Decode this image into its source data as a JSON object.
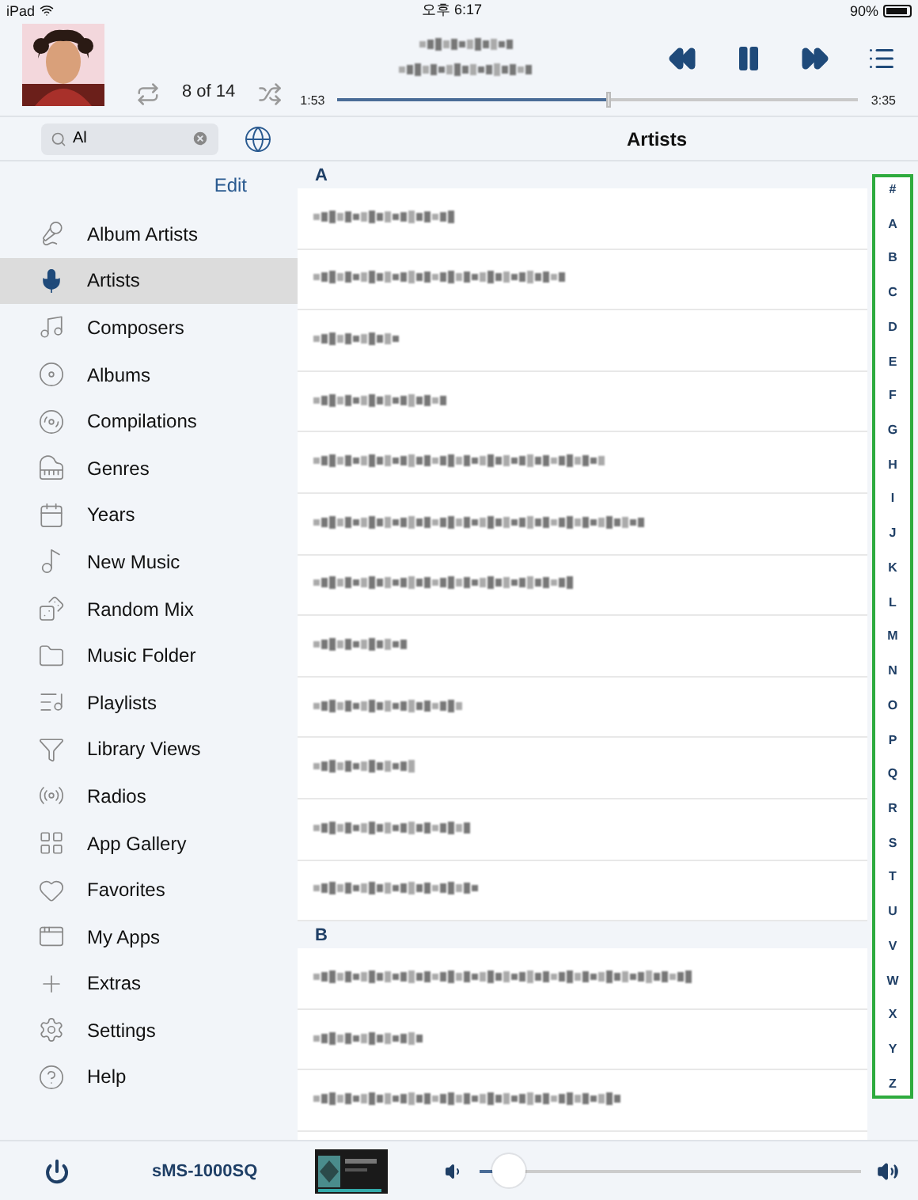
{
  "status_bar": {
    "device": "iPad",
    "time": "오후 6:17",
    "battery": "90%"
  },
  "now_playing": {
    "track_counter": "8 of 14",
    "elapsed": "1:53",
    "remaining": "3:35",
    "level": 0.52,
    "playing": true
  },
  "search": {
    "value": "Al"
  },
  "edit_button": "Edit",
  "title": "Artists",
  "sidebar": {
    "items": [
      {
        "label": "Album Artists",
        "selected": false
      },
      {
        "label": "Artists",
        "selected": true
      },
      {
        "label": "Composers",
        "selected": false
      },
      {
        "label": "Albums",
        "selected": false
      },
      {
        "label": "Compilations",
        "selected": false
      },
      {
        "label": "Genres",
        "selected": false
      },
      {
        "label": "Years",
        "selected": false
      },
      {
        "label": "New Music",
        "selected": false
      },
      {
        "label": "Random Mix",
        "selected": false
      },
      {
        "label": "Music Folder",
        "selected": false
      },
      {
        "label": "Playlists",
        "selected": false
      },
      {
        "label": "Library Views",
        "selected": false
      },
      {
        "label": "Radios",
        "selected": false
      },
      {
        "label": "App Gallery",
        "selected": false
      },
      {
        "label": "Favorites",
        "selected": false
      },
      {
        "label": "My Apps",
        "selected": false
      },
      {
        "label": "Extras",
        "selected": false
      },
      {
        "label": "Settings",
        "selected": false
      },
      {
        "label": "Help",
        "selected": false
      }
    ]
  },
  "sections": [
    {
      "header": "A",
      "rows": [
        {
          "kind": "blurred"
        },
        {
          "kind": "blurred"
        },
        {
          "kind": "blurred"
        },
        {
          "kind": "blurred"
        },
        {
          "kind": "blurred"
        },
        {
          "kind": "blurred"
        },
        {
          "kind": "blurred"
        },
        {
          "kind": "blurred"
        },
        {
          "kind": "blurred"
        },
        {
          "kind": "blurred"
        },
        {
          "kind": "blurred"
        },
        {
          "kind": "blurred"
        }
      ]
    },
    {
      "header": "B",
      "rows": [
        {
          "kind": "blurred"
        },
        {
          "kind": "blurred"
        },
        {
          "kind": "blurred"
        }
      ]
    }
  ],
  "index": [
    "#",
    "A",
    "B",
    "C",
    "D",
    "E",
    "F",
    "G",
    "H",
    "I",
    "J",
    "K",
    "L",
    "M",
    "N",
    "O",
    "P",
    "Q",
    "R",
    "S",
    "T",
    "U",
    "V",
    "W",
    "X",
    "Y",
    "Z"
  ],
  "bottom_bar": {
    "device_name": "sMS-1000SQ",
    "volume": {
      "level": 0.04
    }
  }
}
